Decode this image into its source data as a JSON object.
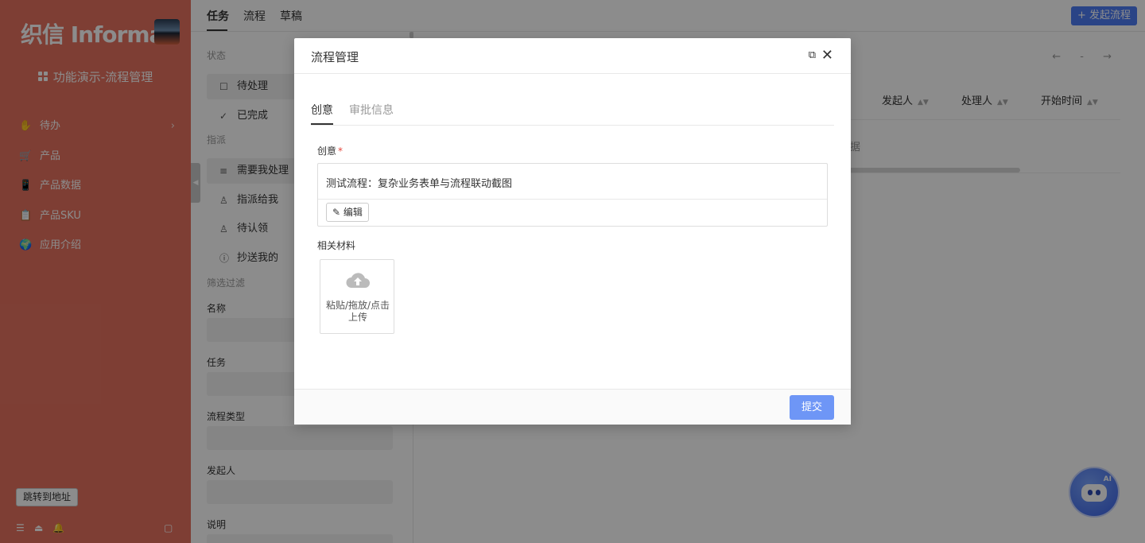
{
  "sidebar": {
    "logo": "织信 Informat",
    "app_title": "功能演示-流程管理",
    "items": [
      {
        "icon": "✋",
        "label": "待办",
        "has_chevron": true
      },
      {
        "icon": "🛒",
        "label": "产品"
      },
      {
        "icon": "📱",
        "label": "产品数据"
      },
      {
        "icon": "📋",
        "label": "产品SKU"
      },
      {
        "icon": "🌍",
        "label": "应用介绍"
      }
    ],
    "jump_button": "跳转到地址",
    "bottom_icons": [
      "menu-icon",
      "eject-icon",
      "bell-icon",
      "sidebar-toggle-icon"
    ]
  },
  "topbar": {
    "tabs": [
      "任务",
      "流程",
      "草稿"
    ],
    "active_tab": "任务",
    "start_button": "+ 发起流程"
  },
  "filter": {
    "status_label": "状态",
    "status_items": [
      {
        "icon": "square-icon",
        "label": "待处理",
        "selected": true
      },
      {
        "icon": "double-check-icon",
        "label": "已完成"
      }
    ],
    "assign_label": "指派",
    "assign_items": [
      {
        "icon": "list-icon",
        "label": "需要我处理",
        "selected": true
      },
      {
        "icon": "user-icon",
        "label": "指派给我"
      },
      {
        "icon": "user-claim-icon",
        "label": "待认领"
      },
      {
        "icon": "info-icon",
        "label": "抄送我的"
      }
    ],
    "filter_label": "筛选过滤",
    "fields": [
      "名称",
      "任务",
      "流程类型",
      "发起人",
      "说明"
    ]
  },
  "content": {
    "pager": "← - →",
    "columns": [
      "发起人",
      "处理人",
      "开始时间"
    ],
    "empty_text": "据"
  },
  "modal": {
    "title": "流程管理",
    "tabs": [
      "创意",
      "审批信息"
    ],
    "active_tab": "创意",
    "field_label": "创意",
    "field_required": "*",
    "field_value": "测试流程：复杂业务表单与流程联动截图",
    "edit_button": "编辑",
    "materials_label": "相关材料",
    "upload_text": "粘贴/拖放/点击上传",
    "submit_button": "提交"
  },
  "ai_assistant": {
    "label": "AI"
  },
  "colors": {
    "sidebar": "#e57260",
    "primary": "#4e7cf5",
    "submit": "#6e96f6"
  }
}
